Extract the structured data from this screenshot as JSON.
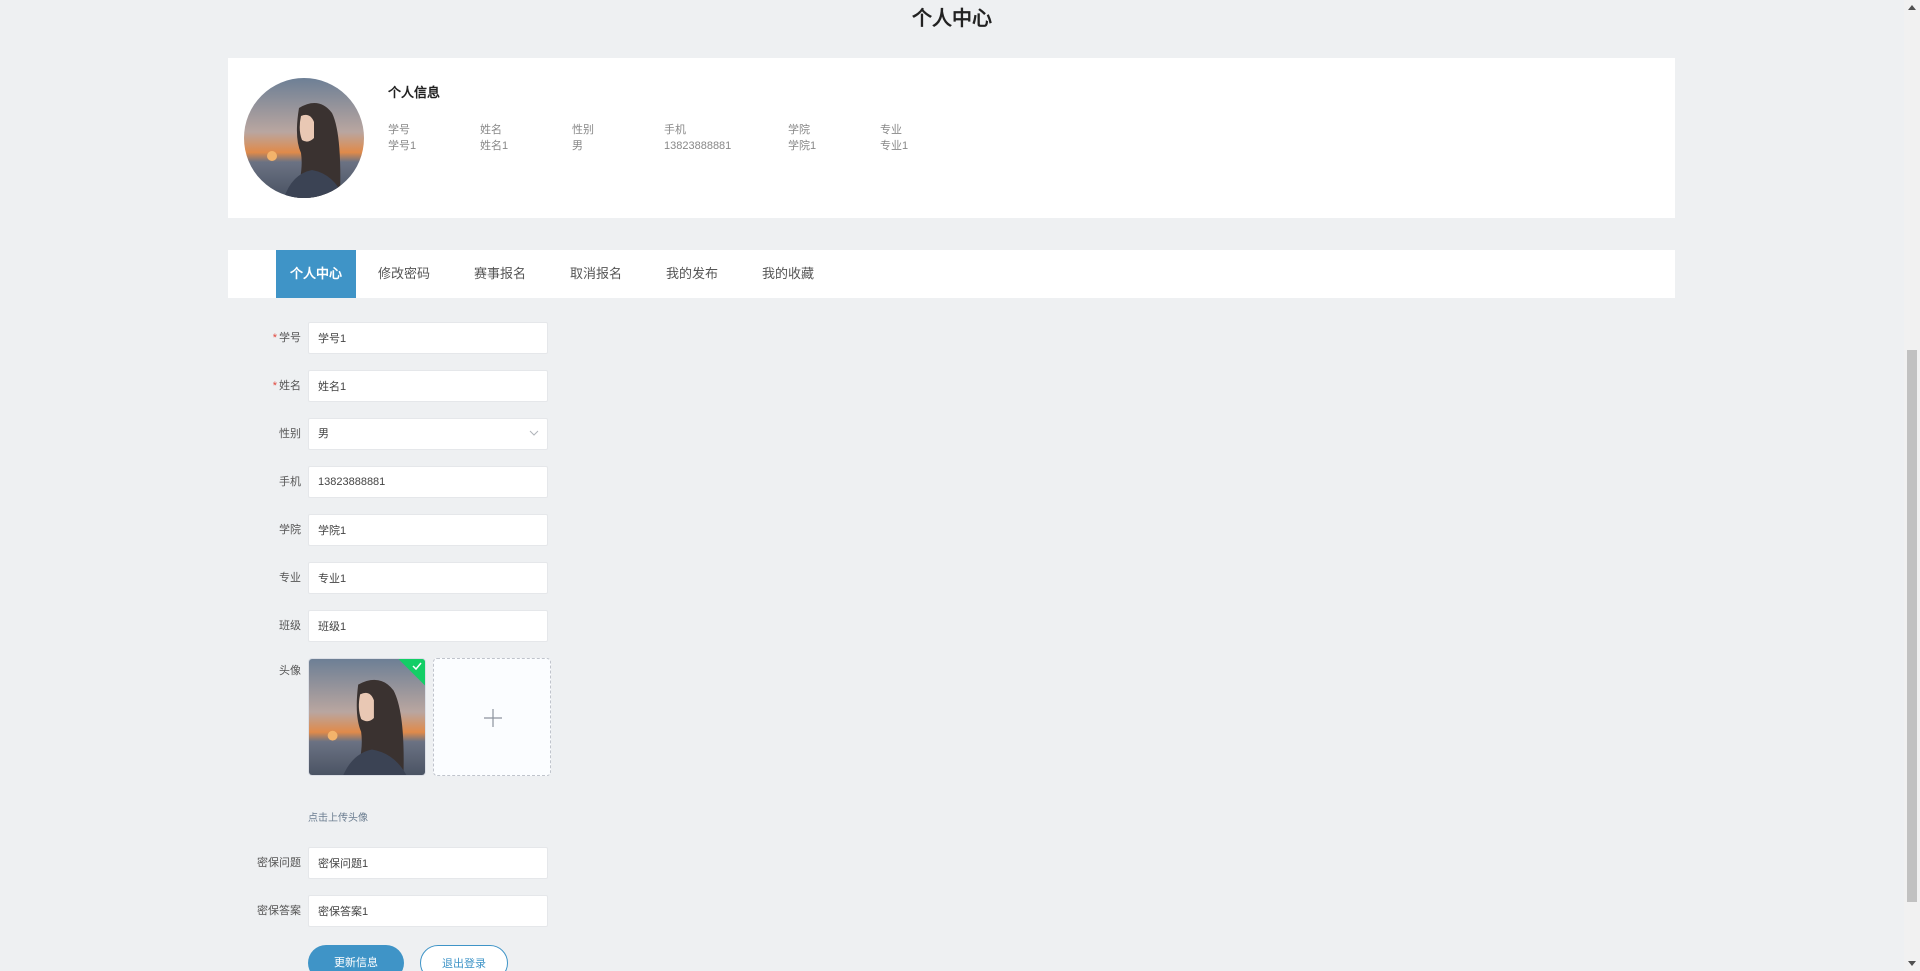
{
  "page": {
    "title": "个人中心"
  },
  "profile": {
    "card_title": "个人信息",
    "fields": [
      {
        "label": "学号",
        "value": "学号1"
      },
      {
        "label": "姓名",
        "value": "姓名1"
      },
      {
        "label": "性别",
        "value": "男"
      },
      {
        "label": "手机",
        "value": "13823888881"
      },
      {
        "label": "学院",
        "value": "学院1"
      },
      {
        "label": "专业",
        "value": "专业1"
      }
    ]
  },
  "tabs": [
    {
      "label": "个人中心",
      "active": true
    },
    {
      "label": "修改密码",
      "active": false
    },
    {
      "label": "赛事报名",
      "active": false
    },
    {
      "label": "取消报名",
      "active": false
    },
    {
      "label": "我的发布",
      "active": false
    },
    {
      "label": "我的收藏",
      "active": false
    }
  ],
  "form": {
    "student_id": {
      "label": "学号",
      "required": "*",
      "value": "学号1"
    },
    "name": {
      "label": "姓名",
      "required": "*",
      "value": "姓名1"
    },
    "gender": {
      "label": "性别",
      "value": "男"
    },
    "phone": {
      "label": "手机",
      "value": "13823888881"
    },
    "college": {
      "label": "学院",
      "value": "学院1"
    },
    "major": {
      "label": "专业",
      "value": "专业1"
    },
    "class": {
      "label": "班级",
      "value": "班级1"
    },
    "avatar": {
      "label": "头像",
      "hint": "点击上传头像"
    },
    "security_question": {
      "label": "密保问题",
      "value": "密保问题1"
    },
    "security_answer": {
      "label": "密保答案",
      "value": "密保答案1"
    },
    "update_button": "更新信息",
    "logout_button": "退出登录"
  },
  "colors": {
    "accent": "#3f94c7",
    "success": "#13ce66",
    "required": "#e0463c",
    "background": "#eef0f2"
  },
  "icons": [
    "chevron-down-icon",
    "plus-icon",
    "check-icon",
    "scroll-up-icon",
    "scroll-down-icon"
  ]
}
